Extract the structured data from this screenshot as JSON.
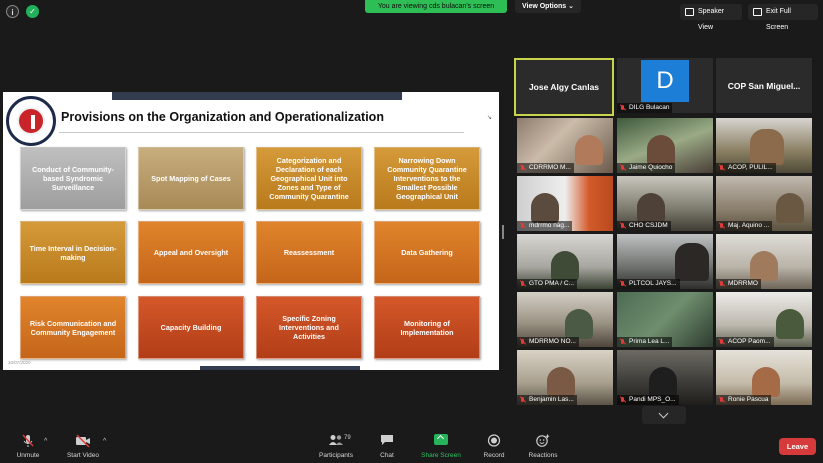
{
  "topbar": {
    "info_icon": "info-icon",
    "shield_icon": "shield-check-icon",
    "viewing_banner": "You are viewing cds bulacan's screen",
    "view_options": "View Options",
    "speaker_view": "Speaker View",
    "exit_full_screen": "Exit Full Screen"
  },
  "slide": {
    "title": "Provisions on the Organization and Operationalization",
    "date": "10/07/2020",
    "boxes": [
      "Conduct of Community-based Syndromic Surveillance",
      "Spot Mapping of Cases",
      "Categorization and Declaration of each Geographical Unit into Zones and Type of Community Quarantine",
      "Narrowing Down Community Quarantine Interventions to the Smallest Possible Geographical Unit",
      "Time Interval in Decision-making",
      "Appeal and Oversight",
      "Reassessment",
      "Data Gathering",
      "Risk Communication and Community Engagement",
      "Capacity Building",
      "Specific Zoning Interventions and Activities",
      "Monitoring of Implementation"
    ]
  },
  "gallery": {
    "tiles": [
      {
        "name": "Jose Algy Canlas",
        "muted": false
      },
      {
        "name": "DILG Bulacan",
        "muted": true,
        "avatar_letter": "D"
      },
      {
        "name": "COP San Miguel...",
        "muted": false
      },
      {
        "name": "CDRRMO M...",
        "muted": true
      },
      {
        "name": "Jaime Quiocho",
        "muted": true
      },
      {
        "name": "ACOP, PULIL...",
        "muted": true
      },
      {
        "name": "mdrrmo nag...",
        "muted": true
      },
      {
        "name": "CHO CSJDM",
        "muted": true
      },
      {
        "name": "Maj. Aquino ...",
        "muted": true
      },
      {
        "name": "GTO PMA / C...",
        "muted": true
      },
      {
        "name": "PLTCOL JAYS...",
        "muted": true
      },
      {
        "name": "MDRRMO",
        "muted": true
      },
      {
        "name": "MDRRMO NO...",
        "muted": true
      },
      {
        "name": "Prima Lea L...",
        "muted": true
      },
      {
        "name": "ACOP Paom...",
        "muted": true
      },
      {
        "name": "Benjamin Las...",
        "muted": true
      },
      {
        "name": "Pandi MPS_O...",
        "muted": true
      },
      {
        "name": "Ronie Pascua",
        "muted": true
      }
    ]
  },
  "toolbar": {
    "unmute": "Unmute",
    "start_video": "Start Video",
    "participants": "Participants",
    "participants_count": "79",
    "chat": "Chat",
    "share_screen": "Share Screen",
    "record": "Record",
    "reactions": "Reactions",
    "leave": "Leave"
  },
  "colors": {
    "share_green": "#27b35a",
    "leave_red": "#d63a3a",
    "active_speaker_border": "#c8d44b",
    "banner_green": "#2dbe56"
  }
}
